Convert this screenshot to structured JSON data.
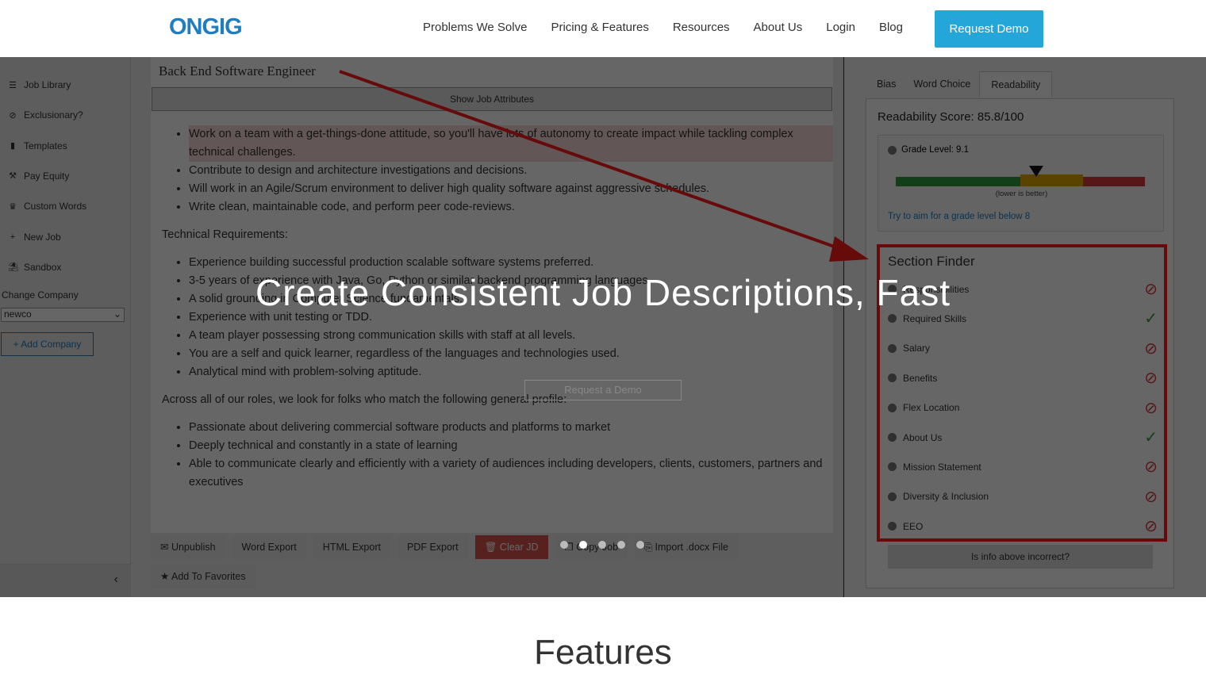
{
  "nav": {
    "logo": "ONGIG",
    "items": [
      "Problems We Solve",
      "Pricing & Features",
      "Resources",
      "About Us",
      "Login",
      "Blog"
    ],
    "cta": "Request Demo"
  },
  "hero": {
    "title": "Create Consistent Job Descriptions, Fast",
    "button": "Request a Demo",
    "slides": 5,
    "active_slide": 2
  },
  "sidebar": {
    "items": [
      {
        "icon": "list-icon",
        "glyph": "☰",
        "label": "Job Library"
      },
      {
        "icon": "ban-icon",
        "glyph": "⊘",
        "label": "Exclusionary?"
      },
      {
        "icon": "file-icon",
        "glyph": "▮",
        "label": "Templates"
      },
      {
        "icon": "gavel-icon",
        "glyph": "⚒",
        "label": "Pay Equity"
      },
      {
        "icon": "trophy-icon",
        "glyph": "♛",
        "label": "Custom Words"
      },
      {
        "icon": "plus-icon",
        "glyph": "+",
        "label": "New Job"
      },
      {
        "icon": "sandbox-icon",
        "glyph": "⛱",
        "label": "Sandbox"
      }
    ],
    "change_company": "Change Company",
    "company": "newco",
    "add_company": "+ Add Company"
  },
  "editor": {
    "title": "Back End Software Engineer",
    "show_attributes": "Show Job Attributes",
    "list1": [
      "Work on a team with a get-things-done attitude, so you'll have lots of autonomy to create impact while tackling complex technical challenges.",
      "Contribute to design and architecture investigations and decisions.",
      "Will work in an Agile/Scrum environment to deliver high quality software against aggressive schedules.",
      "Write clean, maintainable code, and perform peer code-reviews."
    ],
    "heading2": "Technical Requirements:",
    "list2": [
      "Experience building successful production scalable software systems preferred.",
      "3-5 years of experience with Java, Go, Python or similar backend programming languages",
      "A solid grounding in Computer Science fundamentals.",
      "Experience with unit testing or TDD.",
      "A team player possessing strong communication skills with staff at all levels.",
      "You are a self and quick learner, regardless of the languages and technologies used.",
      "Analytical mind with problem-solving aptitude."
    ],
    "heading3": "Across all of our roles, we look for folks who match the following general profile:",
    "list3": [
      "Passionate about delivering commercial software products and platforms to market",
      "Deeply technical and constantly in a state of learning",
      "Able to communicate clearly and efficiently with a variety of audiences including developers, clients, customers, partners and executives"
    ],
    "buttons": [
      "Unpublish",
      "Word Export",
      "HTML Export",
      "PDF Export",
      "Clear JD",
      "Copy Job",
      "Import .docx File",
      "Add To Favorites"
    ]
  },
  "panel": {
    "tabs": [
      "Bias",
      "Word Choice",
      "Readability"
    ],
    "active_tab": "Readability",
    "score": "Readability Score: 85.8/100",
    "grade": "Grade Level: 9.1",
    "grade_note": "(lower is better)",
    "grade_tip": "Try to aim for a grade level below 8",
    "colors": {
      "good": "#2e9e3e",
      "mid": "#e0a800",
      "bad": "#d9383a"
    },
    "section_finder": "Section Finder",
    "sections": [
      {
        "label": "Responsibilities",
        "found": false
      },
      {
        "label": "Required Skills",
        "found": true
      },
      {
        "label": "Salary",
        "found": false
      },
      {
        "label": "Benefits",
        "found": false
      },
      {
        "label": "Flex Location",
        "found": false
      },
      {
        "label": "About Us",
        "found": true
      },
      {
        "label": "Mission Statement",
        "found": false
      },
      {
        "label": "Diversity & Inclusion",
        "found": false
      },
      {
        "label": "EEO",
        "found": false
      }
    ],
    "incorrect": "Is info above incorrect?"
  },
  "features": "Features"
}
